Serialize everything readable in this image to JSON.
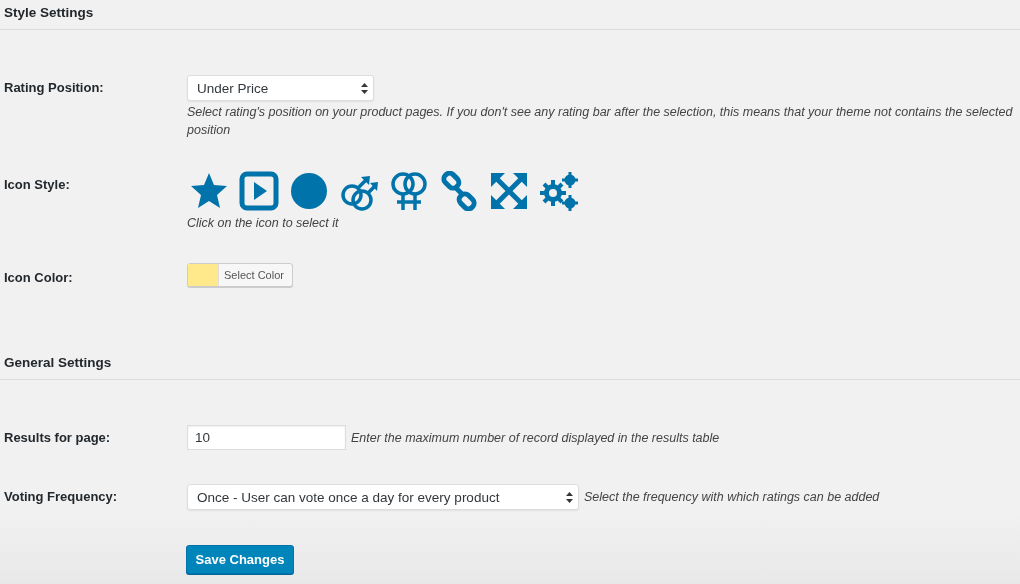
{
  "style_settings": {
    "heading": "Style Settings",
    "rating_position": {
      "label": "Rating Position:",
      "value": "Under Price",
      "description": "Select rating's position on your product pages. If you don't see any rating bar after the selection, this means that your theme not contains the selected position"
    },
    "icon_style": {
      "label": "Icon Style:",
      "icons": [
        {
          "kind": "star"
        },
        {
          "kind": "play"
        },
        {
          "kind": "circle"
        },
        {
          "kind": "male"
        },
        {
          "kind": "female"
        },
        {
          "kind": "link"
        },
        {
          "kind": "expand"
        },
        {
          "kind": "gears"
        }
      ],
      "hint": "Click on the icon to select it"
    },
    "icon_color": {
      "label": "Icon Color:",
      "color": "#ffe98a",
      "button": "Select Color"
    }
  },
  "general_settings": {
    "heading": "General Settings",
    "results_for_page": {
      "label": "Results for page:",
      "value": "10",
      "description": "Enter the maximum number of record displayed in the results table"
    },
    "voting_frequency": {
      "label": "Voting Frequency:",
      "value": "Once - User can vote once a day for every product",
      "description": "Select the frequency with which ratings can be added"
    }
  },
  "save_button": "Save Changes"
}
